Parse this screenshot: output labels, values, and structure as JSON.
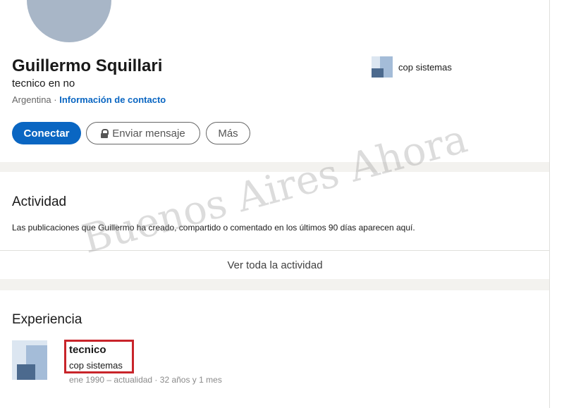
{
  "profile": {
    "name": "Guillermo Squillari",
    "headline": "tecnico en no",
    "location": "Argentina",
    "separator": "·",
    "contact_link": "Información de contacto",
    "current_company": "cop sistemas"
  },
  "actions": {
    "connect": "Conectar",
    "message": "Enviar mensaje",
    "more": "Más"
  },
  "activity": {
    "title": "Actividad",
    "description": "Las publicaciones que Guillermo ha creado, compartido o comentado en los últimos 90 días aparecen aquí.",
    "see_all": "Ver toda la actividad"
  },
  "experience": {
    "title": "Experiencia",
    "items": [
      {
        "role": "tecnico",
        "company": "cop sistemas",
        "dates": "ene 1990 – actualidad · 32 años y 1 mes"
      }
    ]
  },
  "watermark": "Buenos Aires Ahora",
  "colors": {
    "primary": "#0a66c2",
    "highlight_box": "#c8242a",
    "gap_background": "#f3f2ef"
  }
}
